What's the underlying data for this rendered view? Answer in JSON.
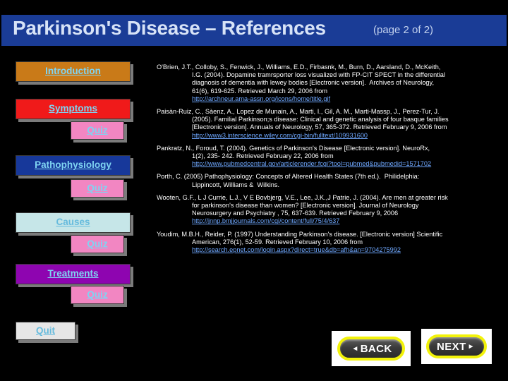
{
  "slide": {
    "title": "Parkinson's Disease – References",
    "page_label": "(page 2 of 2)",
    "banner_color": "#1A3C96",
    "background_color": "#000000"
  },
  "sidebar": {
    "items": [
      {
        "label": "Introduction",
        "color": "#C97A18"
      },
      {
        "label": "Symptoms",
        "color": "#F01A1A"
      },
      {
        "label": "Quiz",
        "color": "#F286C2"
      },
      {
        "label": "Pathophysiology",
        "color": "#17389A"
      },
      {
        "label": "Quiz",
        "color": "#F286C2"
      },
      {
        "label": "Causes",
        "color": "#C6E6E8"
      },
      {
        "label": "Quiz",
        "color": "#F286C2"
      },
      {
        "label": "Treatments",
        "color": "#8E05B0"
      },
      {
        "label": "Quiz",
        "color": "#F286C2"
      },
      {
        "label": "Quit",
        "color": "#E6E6E6"
      }
    ]
  },
  "references": [
    {
      "lines": [
        "O'Brien, J.T., Colloby, S., Fenwick, J., Williams, E.D., Firbasnk, M., Burn, D., Aarsland, D., McKeith,",
        "I.G. (2004). Dopamine tramrsporter loss visualized with FP-CIT SPECT in the differential",
        "diagnosis of dementia with lewey bodies [Electronic version].  Archives of Neurology,",
        "61(6), 619-625. Retrieved March 29, 2006 from"
      ],
      "url": "http://archneur.ama-assn.org/icons/home/title.gif"
    },
    {
      "lines": [
        "Paisàn-Ruiz, C., Sàenz, A., Lopez de Munain, A., Marti, I., Gil, A. M., Marti-Massp, J., Perez-Tur, J.",
        "(2005). Familial Parkinson;s disease: Clinical and genetic analysis of four basque families",
        "[Electronic version]. Annuals of Neurology, 57, 365-372. Retrieved February 9, 2006 from"
      ],
      "url": "http://www3.interscience.wiley.com/cgi-bin/fulltext/109931600"
    },
    {
      "lines": [
        "Pankratz, N., Foroud, T. (2004). Genetics of Parkinson's Disease [Electronic version]. NeuroRx,",
        "1(2), 235- 242. Retrieved February 22, 2006 from"
      ],
      "url": "http://www.pubmedcentral.gov/articlerender.fcgi?tool=pubmed&pubmedid=1571702"
    },
    {
      "lines": [
        "Porth, C. (2005) Pathophysiology: Concepts of Altered Health States (7th ed.).  Philidelphia:",
        "Lippincott, Williams &  Wilkins."
      ],
      "url": ""
    },
    {
      "lines": [
        "Wooten, G.F., L J Currie, L.J., V E Bovbjerg, V.E., Lee, J.K.,J Patrie, J. (2004). Are men at greater risk",
        "for parkinson's disease than women? [Electronic version]. Journal of Neurology",
        "Neurosurgery and Psychiatry , 75, 637-639. Retrieved February 9, 2006"
      ],
      "url": "http://jnnp.bmjjournals.com/cgi/content/full/75/4/637"
    },
    {
      "lines": [
        "Youdim, M.B.H., Reider, P. (1997) Understanding Parkinson's disease. [Electronic version] Scientific",
        "American, 276(1), 52-59. Retrieved February 10, 2006 from"
      ],
      "url": "http://search.epnet.com/login.aspx?direct=true&db=afh&an=9704275992"
    }
  ],
  "footer": {
    "back_label": "BACK",
    "next_label": "NEXT",
    "back_arrow": "◄",
    "next_arrow": "►",
    "accent_color": "#F2F20A"
  }
}
